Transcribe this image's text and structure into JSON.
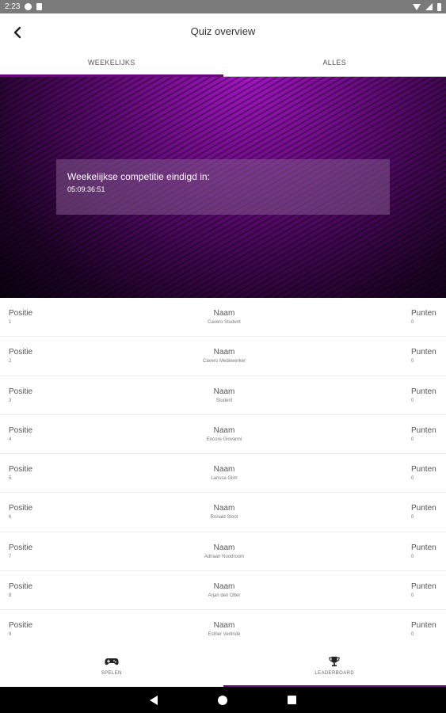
{
  "status_bar": {
    "time": "2:23"
  },
  "app_bar": {
    "title": "Quiz overview"
  },
  "tabs": [
    {
      "label": "WEEKELIJKS",
      "active": true
    },
    {
      "label": "ALLES",
      "active": false
    }
  ],
  "banner": {
    "label": "Weekelijkse competitie eindigd in:",
    "countdown": "05:09:36:51"
  },
  "columns": {
    "position": "Positie",
    "name": "Naam",
    "points": "Punten"
  },
  "rows": [
    {
      "position": "1",
      "name": "Cavero Student",
      "points": "0"
    },
    {
      "position": "2",
      "name": "Cavero Medewerker",
      "points": "0"
    },
    {
      "position": "3",
      "name": "Student",
      "points": "0"
    },
    {
      "position": "4",
      "name": "Encore Giovanni",
      "points": "0"
    },
    {
      "position": "5",
      "name": "Larissa Glim",
      "points": "0"
    },
    {
      "position": "6",
      "name": "Ronald Stoot",
      "points": "0"
    },
    {
      "position": "7",
      "name": "Adriaan Noodroom",
      "points": "0"
    },
    {
      "position": "8",
      "name": "Arjan den Otter",
      "points": "0"
    },
    {
      "position": "9",
      "name": "Esther Verlinde",
      "points": "0"
    }
  ],
  "bottom_nav": [
    {
      "label": "SPELEN",
      "icon": "gamepad-icon",
      "active": false
    },
    {
      "label": "LEADERBOARD",
      "icon": "trophy-icon",
      "active": true
    }
  ],
  "colors": {
    "accent": "#6a0a7a"
  }
}
